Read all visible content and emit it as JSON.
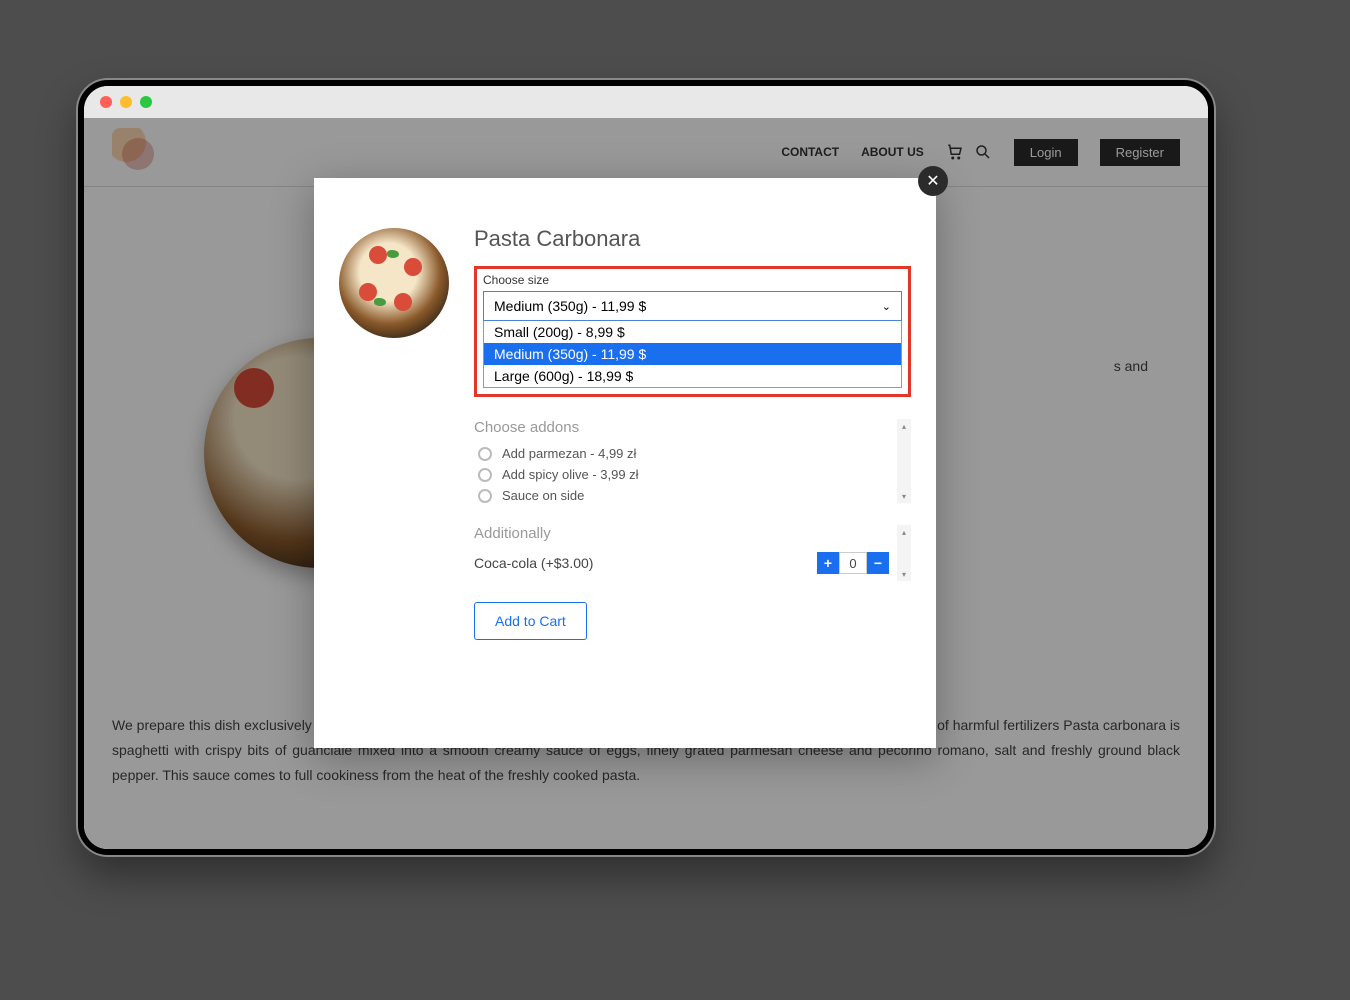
{
  "header": {
    "nav": {
      "contact": "CONTACT",
      "about": "ABOUT US"
    },
    "login": "Login",
    "register": "Register"
  },
  "modal": {
    "title": "Pasta Carbonara",
    "size_label": "Choose size",
    "size_selected": "Medium (350g) - 11,99 $",
    "size_options": [
      "Small (200g) - 8,99 $",
      "Medium (350g) - 11,99 $",
      "Large (600g) - 18,99 $"
    ],
    "addons_label": "Choose addons",
    "addons": [
      "Add parmezan - 4,99 zł",
      "Add spicy olive - 3,99 zł",
      "Sauce on side"
    ],
    "additionally_label": "Additionally",
    "extra_item": "Coca-cola (+$3.00)",
    "extra_qty": "0",
    "add_to_cart": "Add to Cart"
  },
  "bg": {
    "snip1": "s and",
    "desc": "We prepare this dish exclusively from the best Italian products and according to the recipe of local chefs. All products without the use of harmful fertilizers Pasta carbonara is spaghetti with crispy bits of guanciale mixed into a smooth creamy sauce of eggs, finely grated parmesan cheese and pecorino romano, salt and freshly ground black pepper. This sauce comes to full cookiness from the heat of the freshly cooked pasta."
  }
}
